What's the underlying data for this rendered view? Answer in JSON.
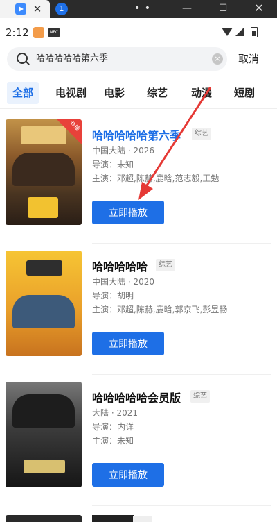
{
  "window": {
    "tab_close_glyph": "✕",
    "tab_badge": "1",
    "more_glyph": "• • •",
    "min_glyph": "—",
    "max_glyph": "☐",
    "close_glyph": "✕"
  },
  "status": {
    "time": "2:12",
    "nfc_label": "NFC"
  },
  "search": {
    "value": "哈哈哈哈哈第六季",
    "clear_glyph": "×",
    "cancel_label": "取消"
  },
  "tabs": [
    {
      "label": "全部",
      "active": true
    },
    {
      "label": "电视剧"
    },
    {
      "label": "电影"
    },
    {
      "label": "综艺"
    },
    {
      "label": "动漫"
    },
    {
      "label": "短剧"
    }
  ],
  "results": [
    {
      "title": "哈哈哈哈哈第六季",
      "type_tag": "综艺",
      "region_year": "中国大陆 · 2026",
      "director": "导演：未知",
      "cast": "主演：邓超,陈赫,鹿晗,范志毅,王勉",
      "play_label": "立即播放",
      "hot_badge": "热播"
    },
    {
      "title": "哈哈哈哈哈",
      "type_tag": "综艺",
      "region_year": "中国大陆 · 2020",
      "director": "导演：胡明",
      "cast": "主演：邓超,陈赫,鹿晗,郭京飞,彭昱畅",
      "play_label": "立即播放"
    },
    {
      "title": "哈哈哈哈哈会员版",
      "type_tag": "综艺",
      "region_year": "大陆 · 2021",
      "director": "导演：内详",
      "cast": "主演：未知",
      "play_label": "立即播放"
    }
  ],
  "colors": {
    "accent": "#1e6fe6",
    "hot": "#e8413a",
    "annotation_arrow": "#e53935"
  }
}
